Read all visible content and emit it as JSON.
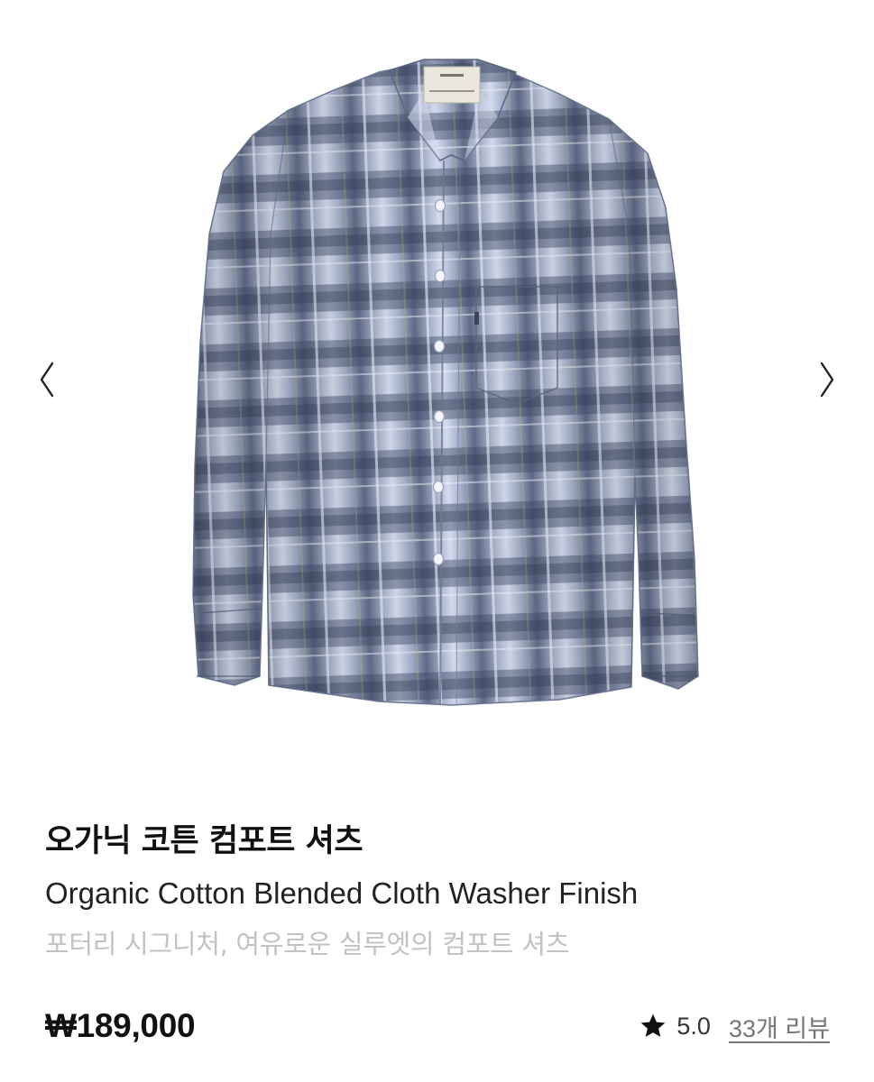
{
  "gallery": {
    "prev_icon": "chevron-left-icon",
    "next_icon": "chevron-right-icon",
    "image_alt": "오가닉 코튼 컴포트 셔츠"
  },
  "product": {
    "title_ko": "오가닉 코튼 컴포트 셔츠",
    "title_en": "Organic Cotton Blended Cloth Washer Finish",
    "subtitle": "포터리 시그니처, 여유로운 실루엣의 컴포트 셔츠",
    "price": "₩189,000",
    "rating": "5.0",
    "reviews_label": "33개 리뷰"
  },
  "colors": {
    "accent": "#111111",
    "subtitle": "#c2c2c2",
    "reviews_link": "#777777",
    "shirt_light": "#c9d2e6",
    "shirt_dark": "#5a6580"
  }
}
